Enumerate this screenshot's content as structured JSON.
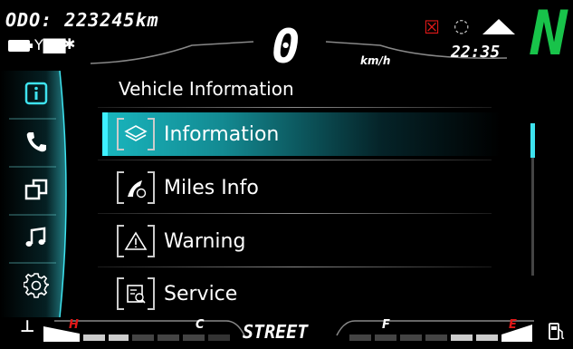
{
  "status_bar": {
    "odometer": "ODO: 223245km",
    "speed": "0",
    "speed_unit": "km/h",
    "time": "22:35",
    "gear": "N",
    "bluetooth_icon": "✱",
    "signal_icon": "Y▇▇"
  },
  "sidebar": {
    "items": [
      {
        "name": "info"
      },
      {
        "name": "phone"
      },
      {
        "name": "media-switch"
      },
      {
        "name": "music"
      },
      {
        "name": "settings"
      }
    ],
    "active_index": 0,
    "accent_color": "#3ee3ef"
  },
  "page": {
    "title": "Vehicle Information"
  },
  "menu": {
    "items": [
      {
        "label": "Information",
        "icon": "layers-icon"
      },
      {
        "label": "Miles Info",
        "icon": "road-icon"
      },
      {
        "label": "Warning",
        "icon": "warning-icon"
      },
      {
        "label": "Service",
        "icon": "service-icon"
      }
    ],
    "selected_index": 0
  },
  "bottom_bar": {
    "riding_mode": "STREET",
    "temp_hot_label": "H",
    "temp_cold_label": "C",
    "fuel_full_label": "F",
    "fuel_empty_label": "E"
  },
  "colors": {
    "gear": "#18c34a",
    "warning": "#e01818",
    "selected": "#19b6be"
  }
}
